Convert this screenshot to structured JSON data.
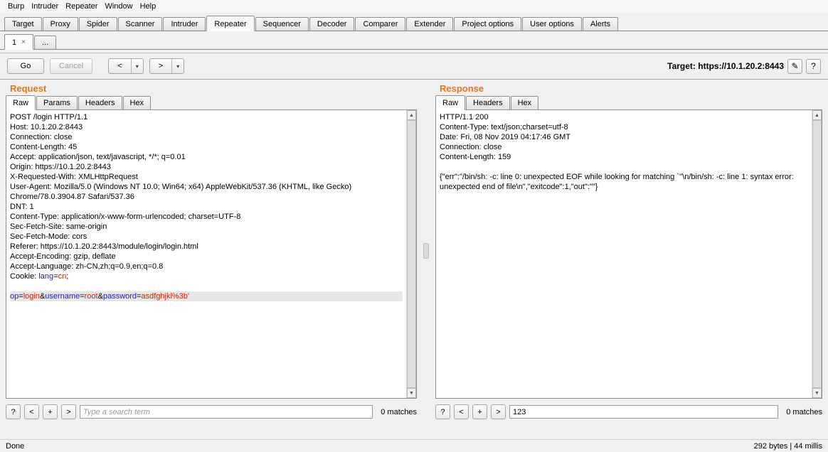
{
  "menu": {
    "items": [
      "Burp",
      "Intruder",
      "Repeater",
      "Window",
      "Help"
    ]
  },
  "main_tabs": {
    "items": [
      "Target",
      "Proxy",
      "Spider",
      "Scanner",
      "Intruder",
      "Repeater",
      "Sequencer",
      "Decoder",
      "Comparer",
      "Extender",
      "Project options",
      "User options",
      "Alerts"
    ],
    "selected": "Repeater"
  },
  "repeater_tabs": {
    "items": [
      {
        "label": "1",
        "close": "×",
        "selected": true
      },
      {
        "label": "...",
        "close": null,
        "selected": false
      }
    ]
  },
  "toolbar": {
    "go_label": "Go",
    "cancel_label": "Cancel",
    "prev_label": "<",
    "next_label": ">",
    "dropdown_icon": "▾",
    "target_label": "Target:",
    "target_value": "https://10.1.20.2:8443",
    "edit_icon": "✎",
    "help_label": "?"
  },
  "colors": {
    "section_title": "#e8731e",
    "param_name": "#1c1cc8",
    "param_value": "#cc2200",
    "highlight_bg": "#e6e6e6"
  },
  "request": {
    "title": "Request",
    "tabs": [
      "Raw",
      "Params",
      "Headers",
      "Hex"
    ],
    "selected_tab": "Raw",
    "lines": [
      "POST /login HTTP/1.1",
      "Host: 10.1.20.2:8443",
      "Connection: close",
      "Content-Length: 45",
      "Accept: application/json, text/javascript, */*; q=0.01",
      "Origin: https://10.1.20.2:8443",
      "X-Requested-With: XMLHttpRequest",
      "User-Agent: Mozilla/5.0 (Windows NT 10.0; Win64; x64) AppleWebKit/537.36 (KHTML, like Gecko) Chrome/78.0.3904.87 Safari/537.36",
      "DNT: 1",
      "Content-Type: application/x-www-form-urlencoded; charset=UTF-8",
      "Sec-Fetch-Site: same-origin",
      "Sec-Fetch-Mode: cors",
      "Referer: https://10.1.20.2:8443/module/login/login.html",
      "Accept-Encoding: gzip, deflate",
      "Accept-Language: zh-CN,zh;q=0.9,en;q=0.8",
      {
        "seg": [
          {
            "t": "Cookie: "
          },
          {
            "t": "lang",
            "c": "param_name"
          },
          {
            "t": "="
          },
          {
            "t": "cn",
            "c": "param_value"
          },
          {
            "t": ";"
          }
        ]
      },
      "",
      {
        "hl": true,
        "seg": [
          {
            "t": "op",
            "c": "param_name"
          },
          {
            "t": "="
          },
          {
            "t": "login",
            "c": "param_value"
          },
          {
            "t": "&"
          },
          {
            "t": "username",
            "c": "param_name"
          },
          {
            "t": "="
          },
          {
            "t": "root",
            "c": "param_value"
          },
          {
            "t": "&"
          },
          {
            "t": "password",
            "c": "param_name"
          },
          {
            "t": "="
          },
          {
            "t": "asdfghjkl%3b'",
            "c": "param_value"
          }
        ]
      }
    ],
    "search": {
      "buttons": [
        "?",
        "<",
        "+",
        ">"
      ],
      "placeholder": "Type a search term",
      "value": "",
      "matches": "0 matches"
    }
  },
  "response": {
    "title": "Response",
    "tabs": [
      "Raw",
      "Headers",
      "Hex"
    ],
    "selected_tab": "Raw",
    "lines": [
      "HTTP/1.1 200",
      "Content-Type: text/json;charset=utf-8",
      "Date: Fri, 08 Nov 2019 04:17:46 GMT",
      "Connection: close",
      "Content-Length: 159",
      "",
      "{\"err\":\"/bin/sh: -c: line 0: unexpected EOF while looking for matching `''\\n/bin/sh: -c: line 1: syntax error: unexpected end of file\\n\",\"exitcode\":1,\"out\":\"\"}"
    ],
    "search": {
      "buttons": [
        "?",
        "<",
        "+",
        ">"
      ],
      "placeholder": "",
      "value": "123",
      "matches": "0 matches"
    }
  },
  "status_bar": {
    "left": "Done",
    "right": "292 bytes | 44 millis"
  }
}
